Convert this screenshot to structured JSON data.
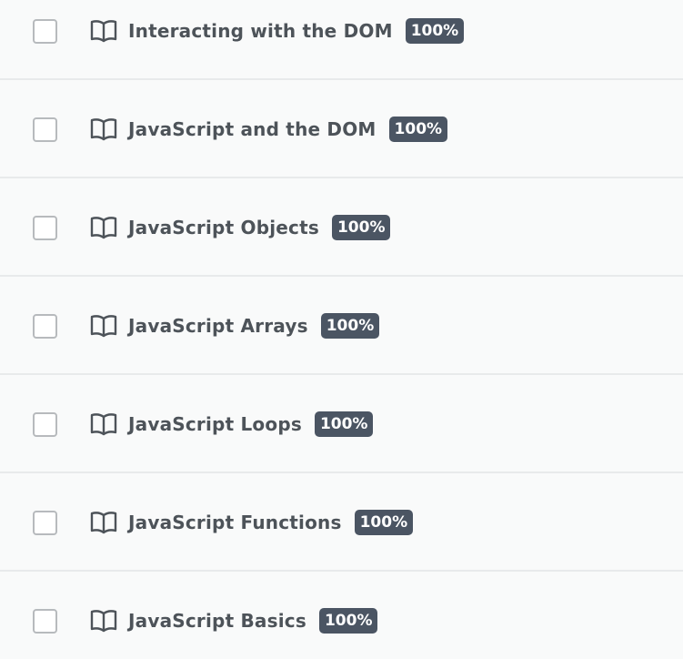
{
  "lessons": [
    {
      "title": "Interacting with the DOM",
      "progress_label": "100%",
      "progress": 100,
      "checked": false
    },
    {
      "title": "JavaScript and the DOM",
      "progress_label": "100%",
      "progress": 100,
      "checked": false
    },
    {
      "title": "JavaScript Objects",
      "progress_label": "100%",
      "progress": 100,
      "checked": false
    },
    {
      "title": "JavaScript Arrays",
      "progress_label": "100%",
      "progress": 100,
      "checked": false
    },
    {
      "title": "JavaScript Loops",
      "progress_label": "100%",
      "progress": 100,
      "checked": false
    },
    {
      "title": "JavaScript Functions",
      "progress_label": "100%",
      "progress": 100,
      "checked": false
    },
    {
      "title": "JavaScript Basics",
      "progress_label": "100%",
      "progress": 100,
      "checked": false
    }
  ],
  "icons": {
    "row_icon": "book-open-icon",
    "checkbox": "checkbox-unchecked"
  },
  "colors": {
    "badge_bg": "#4b5563",
    "title_text": "#4d5359",
    "checkbox_border": "#b7babd",
    "background": "#f9fafa",
    "separator": "#e8eaeb"
  }
}
